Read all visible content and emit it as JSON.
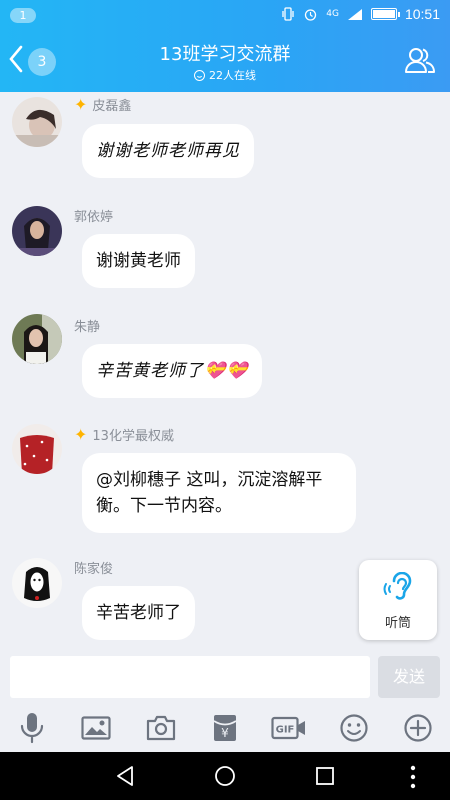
{
  "status_bar": {
    "notification_count": "1",
    "network": "4G",
    "time": "10:51"
  },
  "header": {
    "back_unread_count": "3",
    "title": "13班学习交流群",
    "online_status": "22人在线",
    "members_icon": "members-icon"
  },
  "messages": [
    {
      "sender": "皮磊鑫",
      "badge": "star-badge",
      "text": "谢谢老师老师再见",
      "style": "handwriting"
    },
    {
      "sender": "郭依婷",
      "text": "谢谢黄老师"
    },
    {
      "sender": "朱静",
      "text": "辛苦黄老师了",
      "emoji": "💝💝",
      "style": "handwriting"
    },
    {
      "sender": "13化学最权威",
      "badge": "star-badge",
      "text": "@刘柳穗子 这叫，沉淀溶解平衡。下一节内容。"
    },
    {
      "sender": "陈家俊",
      "text": "辛苦老师了"
    }
  ],
  "earpiece": {
    "label": "听筒"
  },
  "input": {
    "value": "",
    "placeholder": ""
  },
  "send_button": {
    "label": "发送"
  },
  "toolbar": {
    "items": [
      "microphone-icon",
      "image-icon",
      "camera-icon",
      "red-packet-icon",
      "gif-icon",
      "emoji-icon",
      "plus-icon"
    ],
    "red_packet_symbol": "¥",
    "gif_label": "GIF"
  },
  "colors": {
    "header_gradient_start": "#23b6f5",
    "header_gradient_end": "#3b9bf3",
    "chat_background": "#eef0f5",
    "bubble": "#ffffff",
    "send_disabled": "#dadde3",
    "icon_gray": "#6d7480"
  }
}
